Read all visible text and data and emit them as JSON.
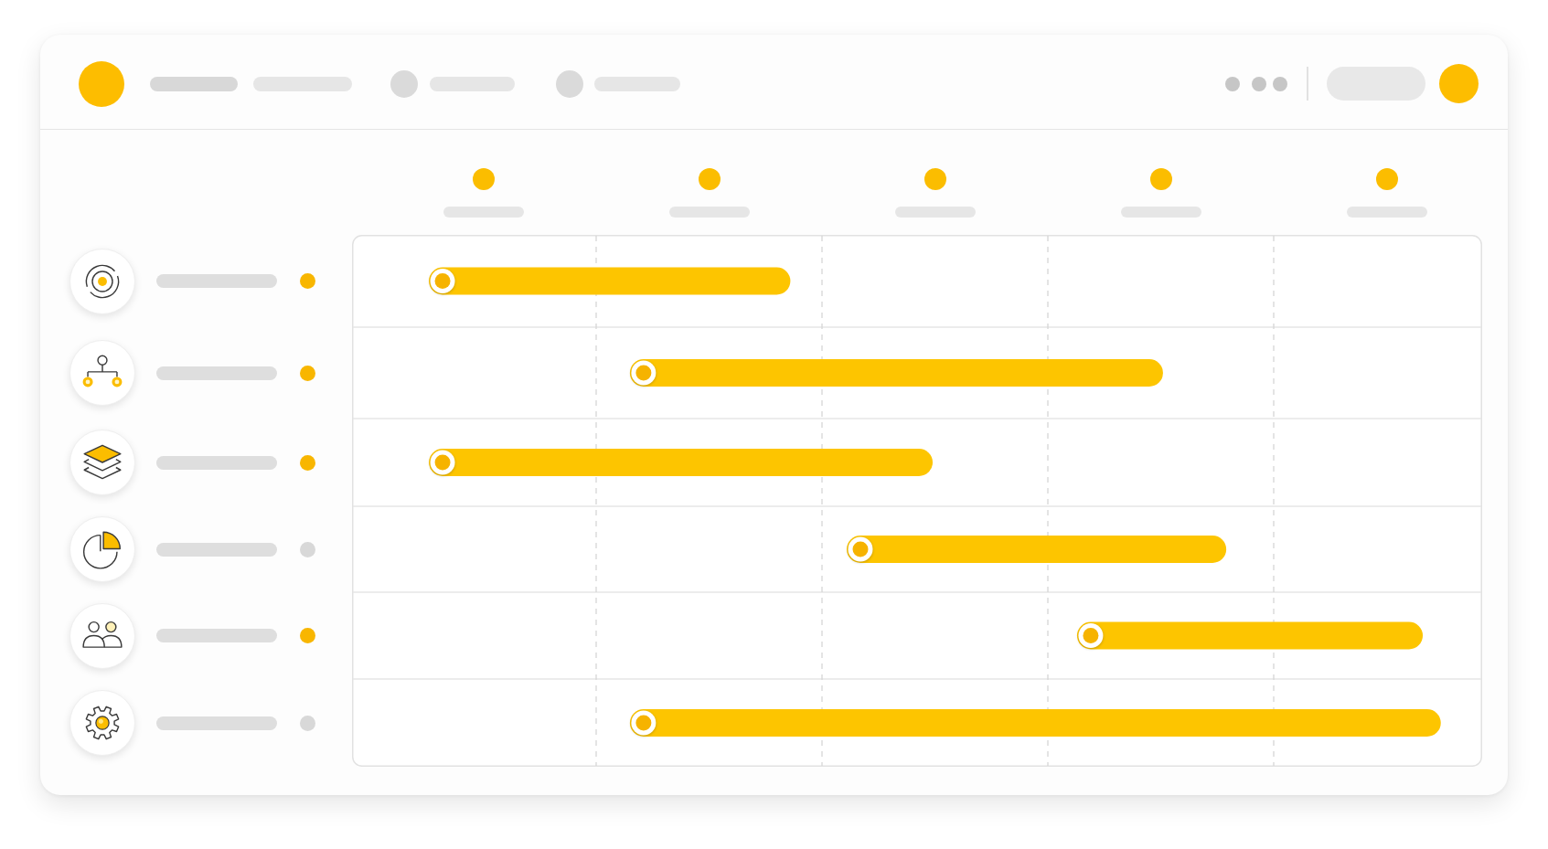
{
  "rows": [
    {
      "color": "#f8b600"
    },
    {
      "color": "#f8b600"
    },
    {
      "color": "#f8b600"
    },
    {
      "color": "#d8d8d8"
    },
    {
      "color": "#f8b600"
    },
    {
      "color": "#d8d8d8"
    }
  ]
}
